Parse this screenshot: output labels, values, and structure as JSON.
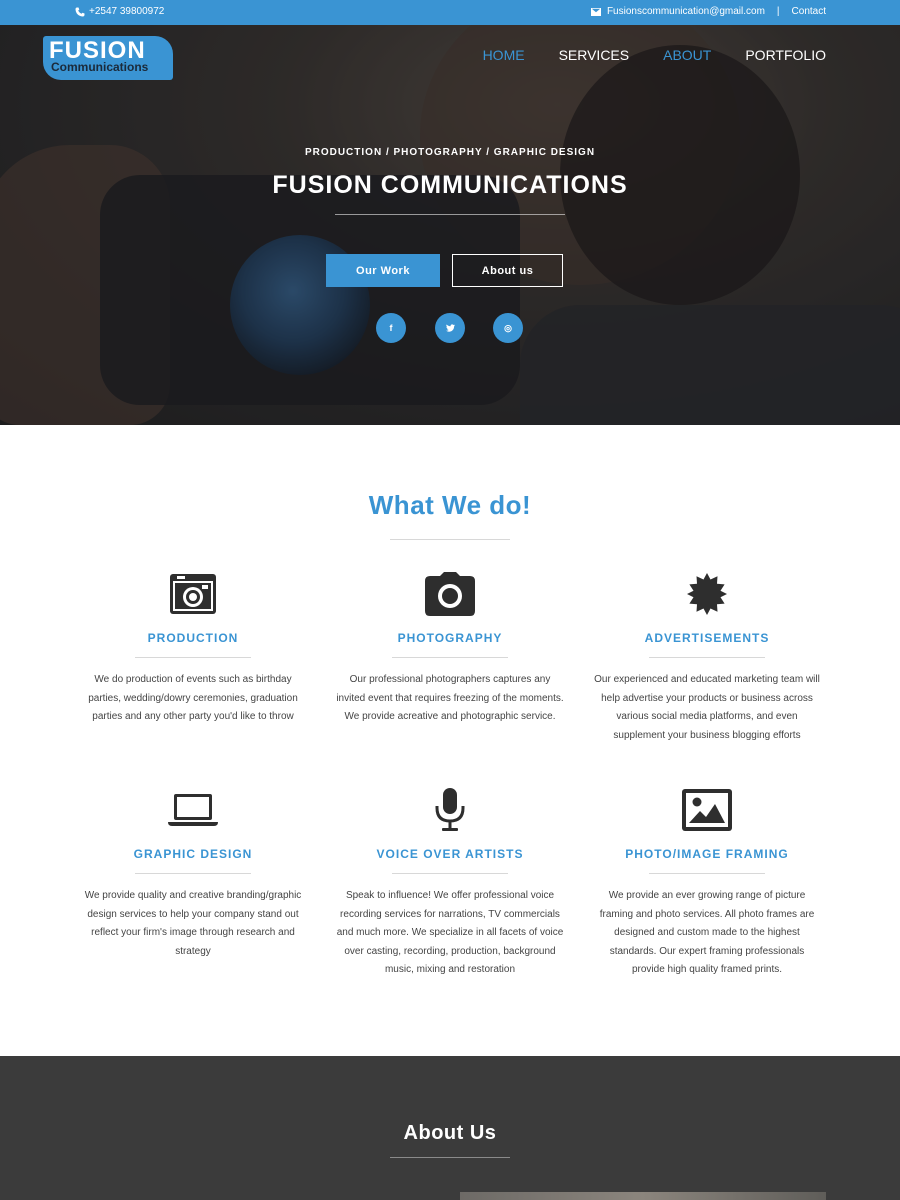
{
  "topbar": {
    "phone": "+2547 39800972",
    "email": "Fusionscommunication@gmail.com",
    "separator": "|",
    "contact": "Contact"
  },
  "logo": {
    "line1": "FUSION",
    "line2": "Communications"
  },
  "nav": [
    {
      "label": "HOME",
      "active": true
    },
    {
      "label": "SERVICES",
      "active": false
    },
    {
      "label": "ABOUT",
      "active": true
    },
    {
      "label": "PORTFOLIO",
      "active": false
    }
  ],
  "hero": {
    "subtitle": "PRODUCTION / PHOTOGRAPHY / GRAPHIC DESIGN",
    "title": "FUSION COMMUNICATIONS",
    "btn_work": "Our Work",
    "btn_about": "About us",
    "social": [
      {
        "icon": "facebook-icon",
        "glyph": "f"
      },
      {
        "icon": "twitter-icon",
        "glyph": "t"
      },
      {
        "icon": "instagram-icon",
        "glyph": "◎"
      }
    ]
  },
  "what_we_do": {
    "title": "What We do!",
    "services": [
      {
        "icon": "film-camera-icon",
        "name": "PRODUCTION",
        "desc": "We do production of events such as birthday parties, wedding/dowry ceremonies, graduation parties and any other party you'd like to throw"
      },
      {
        "icon": "camera-icon",
        "name": "PHOTOGRAPHY",
        "desc": "Our professional photographers captures any invited event that requires freezing of the moments. We provide acreative and photographic service."
      },
      {
        "icon": "badge-icon",
        "name": "ADVERTISEMENTS",
        "desc": "Our experienced and educated marketing team will help advertise your products or business across various social media platforms, and even supplement your business blogging efforts"
      },
      {
        "icon": "laptop-icon",
        "name": "GRAPHIC DESIGN",
        "desc": "We provide quality and creative branding/graphic design services to help your company stand out reflect your firm's image through research and strategy"
      },
      {
        "icon": "microphone-icon",
        "name": "VOICE OVER ARTISTS",
        "desc": "Speak to influence! We offer professional voice recording services for narrations, TV commercials and much more. We specialize in all facets of voice over casting, recording, production, background music, mixing and restoration"
      },
      {
        "icon": "picture-icon",
        "name": "PHOTO/IMAGE FRAMING",
        "desc": "We provide an ever growing range of picture framing and photo services. All photo frames are designed and custom made to the highest standards. Our expert framing professionals provide high quality framed prints."
      }
    ]
  },
  "about": {
    "title": "About Us"
  },
  "colors": {
    "accent": "#3a94d3",
    "dark": "#3b3b3b",
    "text": "#444444"
  }
}
